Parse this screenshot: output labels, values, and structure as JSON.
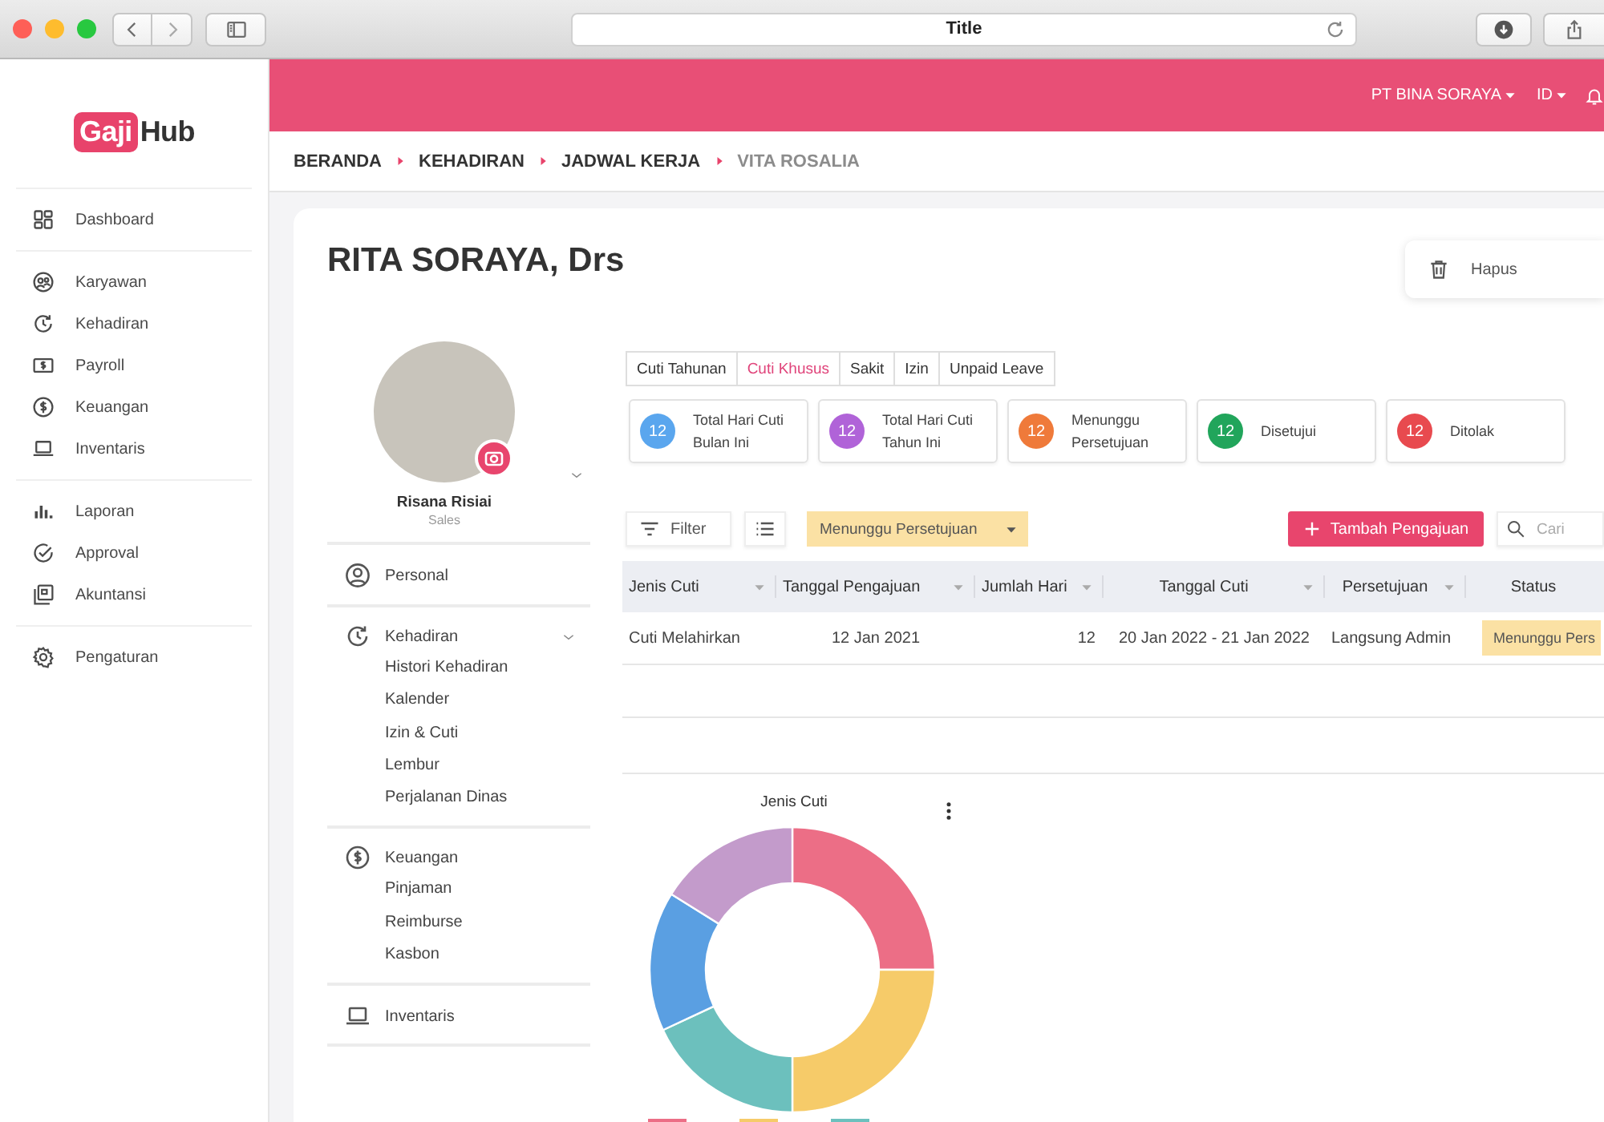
{
  "browser": {
    "title": "Title"
  },
  "logo": {
    "badge": "Gaji",
    "text": "Hub"
  },
  "sidebar": {
    "groups": [
      {
        "items": [
          {
            "label": "Dashboard"
          }
        ]
      },
      {
        "items": [
          {
            "label": "Karyawan"
          },
          {
            "label": "Kehadiran"
          },
          {
            "label": "Payroll"
          },
          {
            "label": "Keuangan"
          },
          {
            "label": "Inventaris"
          }
        ]
      },
      {
        "items": [
          {
            "label": "Laporan"
          },
          {
            "label": "Approval"
          },
          {
            "label": "Akuntansi"
          }
        ]
      },
      {
        "items": [
          {
            "label": "Pengaturan"
          }
        ]
      }
    ]
  },
  "topbar": {
    "company": "PT BINA SORAYA",
    "language": "ID"
  },
  "breadcrumb": [
    {
      "label": "BERANDA",
      "current": false
    },
    {
      "label": "KEHADIRAN",
      "current": false
    },
    {
      "label": "JADWAL KERJA",
      "current": false
    },
    {
      "label": "VITA ROSALIA",
      "current": true
    }
  ],
  "employee": {
    "title": "RITA SORAYA, Drs",
    "delete_button": "Hapus"
  },
  "profile": {
    "name": "Risana Risiai",
    "role": "Sales"
  },
  "profile_menu": [
    {
      "label": "Personal",
      "collapsible": false
    },
    {
      "label": "Kehadiran",
      "collapsible": true,
      "children": [
        {
          "label": "Histori Kehadiran"
        },
        {
          "label": "Kalender"
        },
        {
          "label": "Izin & Cuti"
        },
        {
          "label": "Lembur"
        },
        {
          "label": "Perjalanan Dinas"
        }
      ]
    },
    {
      "label": "Keuangan",
      "collapsible": false,
      "children": [
        {
          "label": "Pinjaman"
        },
        {
          "label": "Reimburse"
        },
        {
          "label": "Kasbon"
        }
      ]
    },
    {
      "label": "Inventaris",
      "collapsible": false
    }
  ],
  "leave_tabs": [
    {
      "label": "Cuti Tahunan",
      "selected": false
    },
    {
      "label": "Cuti Khusus",
      "selected": true
    },
    {
      "label": "Sakit",
      "selected": false
    },
    {
      "label": "Izin",
      "selected": false
    },
    {
      "label": "Unpaid Leave",
      "selected": false
    }
  ],
  "stats": [
    {
      "count": "12",
      "label": "Total Hari Cuti Bulan Ini",
      "color": "#5aa6ee"
    },
    {
      "count": "12",
      "label": "Total Hari Cuti Tahun Ini",
      "color": "#b063d8"
    },
    {
      "count": "12",
      "label": "Menunggu Persetujuan",
      "color": "#ef7a3a"
    },
    {
      "count": "12",
      "label": "Disetujui",
      "color": "#21a55b"
    },
    {
      "count": "12",
      "label": "Ditolak",
      "color": "#e84a4f"
    }
  ],
  "toolbar": {
    "filter_button": "Filter",
    "status_filter": "Menunggu Persetujuan",
    "add_button": "Tambah Pengajuan",
    "search": {
      "placeholder": "Cari"
    }
  },
  "table": {
    "columns": [
      {
        "label": "Jenis Cuti",
        "sortable": true
      },
      {
        "label": "Tanggal Pengajuan",
        "sortable": true
      },
      {
        "label": "Jumlah Hari",
        "sortable": true
      },
      {
        "label": "Tanggal Cuti",
        "sortable": true
      },
      {
        "label": "Persetujuan",
        "sortable": true
      },
      {
        "label": "Status",
        "sortable": false
      }
    ],
    "rows": [
      {
        "cells": [
          "Cuti Melahirkan",
          "12 Jan 2021",
          "12",
          "20 Jan 2022 - 21 Jan 2022",
          "Langsung Admin"
        ],
        "status": "Menunggu Pers"
      }
    ]
  },
  "chart": {
    "title": "Jenis Cuti",
    "slices": [
      {
        "color": "#ec6e86"
      },
      {
        "color": "#f6cb69"
      },
      {
        "color": "#6cc0bd"
      },
      {
        "color": "#5a9fe2"
      },
      {
        "color": "#c39bcb"
      }
    ],
    "legend": [
      {
        "color": "#ec6e86"
      },
      {
        "color": "#f6cb69"
      },
      {
        "color": "#6cc0bd"
      }
    ]
  }
}
